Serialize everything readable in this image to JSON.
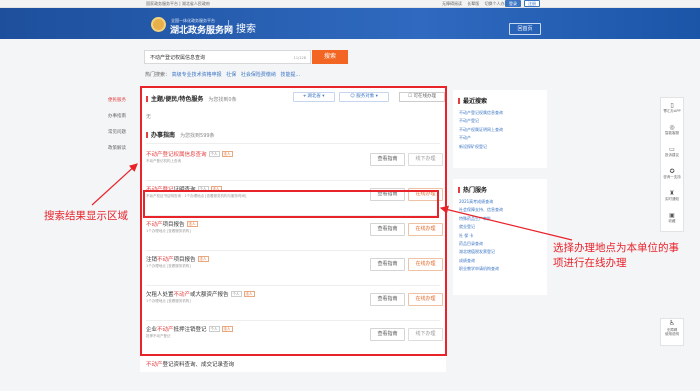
{
  "topbar": {
    "left": "国家政务服务平台 | 湖北省人民政府",
    "right": [
      "无障碍阅读",
      "长辈版",
      "切换个人办事"
    ],
    "login": "登录",
    "register": "注册"
  },
  "header": {
    "site_small": "全国一体化政务服务平台",
    "site_name": "湖北政务服务网",
    "page_title": "搜索",
    "home_btn": "回首页"
  },
  "search": {
    "value": "不动产登记权属信息查询",
    "count": "11/128",
    "button": "搜索"
  },
  "hot": {
    "label": "热门搜索：",
    "items": [
      "高级专业技术资格申报",
      "社保",
      "社会保险费缴纳",
      "技能提..."
    ]
  },
  "leftnav": [
    "便民服务",
    "办事指南",
    "常见问题",
    "政策解读"
  ],
  "section1": {
    "title": "主题/便民/特色服务",
    "count": "为您找到0条",
    "filter_area": "湖北省",
    "filter_target": "服务对象",
    "online_only": "可在线办理",
    "empty": "无"
  },
  "section2": {
    "title": "办事指南",
    "count": "为您找到599条",
    "view_label": "查看指南",
    "apply_label": "在线办理",
    "offline_label": "线下办理",
    "items": [
      {
        "pre": "",
        "kw": "不动产登记权属信息查询",
        "post": "",
        "tags": [
          "个人",
          "法人"
        ],
        "sub": "不动产登记机构上查询",
        "apply": "线下办理"
      },
      {
        "pre": "",
        "kw": "不动产登记",
        "post": "证明查询",
        "tags": [
          "个人",
          "法人"
        ],
        "sub": "不动产权证书证明查询 · 1个办理地点 [查看服务机构与服务时间]",
        "apply": "在线办理"
      },
      {
        "pre": "",
        "kw": "不动产",
        "post": "项目报告",
        "tags": [
          "法人"
        ],
        "sub": "1个办理地点 [查看服务机构]",
        "apply": "在线办理"
      },
      {
        "pre": "注销",
        "kw": "不动产",
        "post": "项目报告",
        "tags": [
          "法人"
        ],
        "sub": "1个办理地点 [查看服务机构]",
        "apply": "在线办理"
      },
      {
        "pre": "欠租人处置",
        "kw": "不动产",
        "post": "或大额资产报告",
        "tags": [
          "个人",
          "法人"
        ],
        "sub": "1个办理地点 [查看服务机构]",
        "apply": "在线办理"
      },
      {
        "pre": "企业",
        "kw": "不动产",
        "post": "抵押注销登记",
        "tags": [
          "个人",
          "法人"
        ],
        "sub": "抵押不动产登记",
        "apply": "线下办理"
      },
      {
        "pre": "",
        "kw": "不动产",
        "post": "登记资料查询、成交记录查询",
        "tags": [],
        "sub": "",
        "apply": ""
      }
    ]
  },
  "recent": {
    "title": "最近搜索",
    "items": [
      "不动产登记权属信息查询",
      "不动产登记",
      "不动产权属证明网上查询",
      "不动产",
      "新设探矿权登记"
    ]
  },
  "hotservice": {
    "title": "热门服务",
    "items": [
      "2021高考成绩查询",
      "社会保障支持、信息查询",
      "特殊药品生产审批",
      "就业登记",
      "社 保 卡",
      "药品目录查询",
      "湖北增值税发票登记",
      "成绩查询",
      "职业教学申请机构查询"
    ]
  },
  "sidetools": [
    {
      "icon": "phone-icon",
      "glyph": "▯",
      "label": "鄂汇办APP"
    },
    {
      "icon": "chat-icon",
      "glyph": "◎",
      "label": "智能客服"
    },
    {
      "icon": "complaint-icon",
      "glyph": "▭",
      "label": "投诉建议"
    },
    {
      "icon": "feedback-icon",
      "glyph": "✪",
      "label": "咨询一支持"
    },
    {
      "icon": "bell-icon",
      "glyph": "♜",
      "label": "实时通知"
    },
    {
      "icon": "collect-icon",
      "glyph": "▣",
      "label": "收藏"
    }
  ],
  "barrier": {
    "label1": "无障碍",
    "label2": "使用说明"
  },
  "annotations": {
    "left": "搜索结果显示区域",
    "right_line1": "选择办理地点为本单位的事",
    "right_line2": "项进行在线办理"
  },
  "colors": {
    "accent": "#f26522",
    "brand": "#1d4f9c",
    "annotation": "#e8232a"
  }
}
